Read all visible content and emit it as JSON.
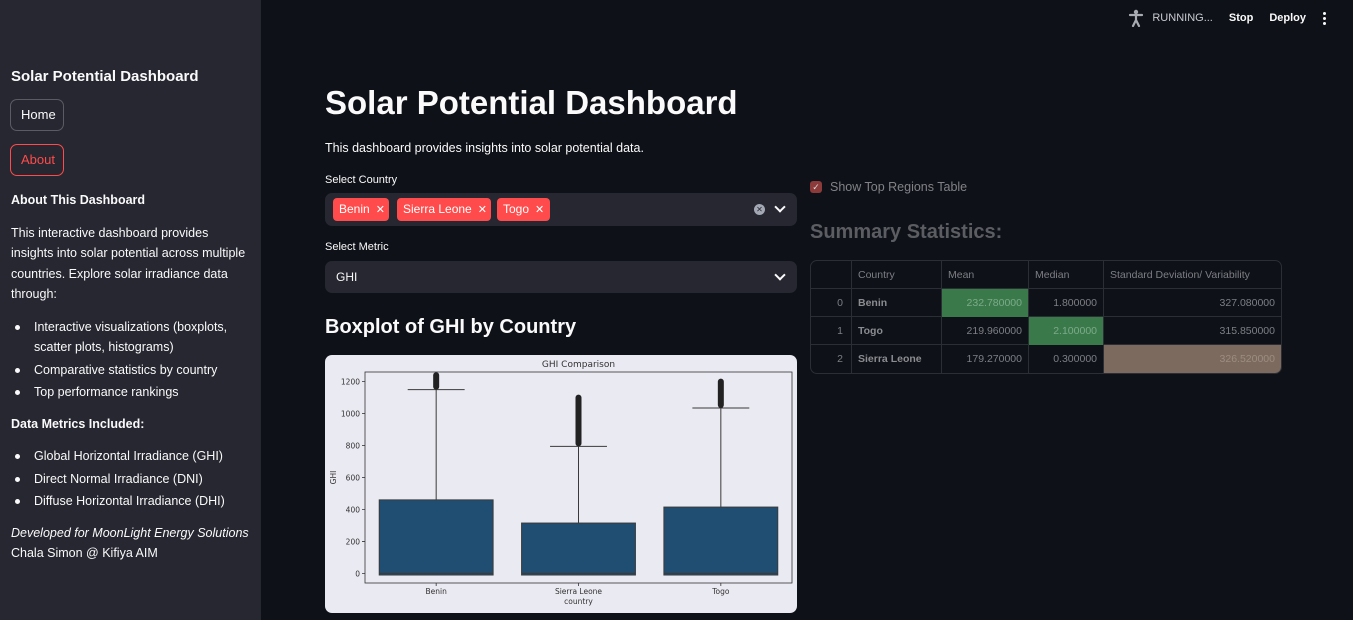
{
  "sidebar": {
    "title": "Solar Potential Dashboard",
    "home_label": "Home",
    "about_label": "About",
    "about_heading": "About This Dashboard",
    "about_text": "This interactive dashboard provides insights into solar potential across multiple countries. Explore solar irradiance data through:",
    "features": [
      "Interactive visualizations (boxplots, scatter plots, histograms)",
      "Comparative statistics by country",
      "Top performance rankings"
    ],
    "metrics_heading": "Data Metrics Included:",
    "metrics": [
      "Global Horizontal Irradiance (GHI)",
      "Direct Normal Irradiance (DNI)",
      "Diffuse Horizontal Irradiance (DHI)"
    ],
    "developed_for": "Developed for MoonLight Energy Solutions",
    "author": "Chala Simon @ Kifiya AIM"
  },
  "topbar": {
    "status": "RUNNING...",
    "stop_label": "Stop",
    "deploy_label": "Deploy"
  },
  "main": {
    "title": "Solar Potential Dashboard",
    "intro": "This dashboard provides insights into solar potential data.",
    "country_label": "Select Country",
    "countries_selected": [
      "Benin",
      "Sierra Leone",
      "Togo"
    ],
    "metric_label": "Select Metric",
    "metric_value": "GHI",
    "boxplot_title": "Boxplot of GHI by Country"
  },
  "right": {
    "checkbox_label": "Show Top Regions Table",
    "summary_title": "Summary Statistics:",
    "table": {
      "headers": [
        "",
        "Country",
        "Mean",
        "Median",
        "Standard Deviation/ Variability"
      ],
      "rows": [
        [
          "0",
          "Benin",
          "232.780000",
          "1.800000",
          "327.080000"
        ],
        [
          "1",
          "Togo",
          "219.960000",
          "2.100000",
          "315.850000"
        ],
        [
          "2",
          "Sierra Leone",
          "179.270000",
          "0.300000",
          "326.520000"
        ]
      ]
    }
  },
  "colors": {
    "accent": "#ff4b4b",
    "box_fill": "#1f4e72",
    "plot_bg": "#eaeaf2"
  },
  "chart_data": {
    "type": "boxplot",
    "title": "GHI Comparison",
    "xlabel": "country",
    "ylabel": "GHI",
    "ylim": [
      -60,
      1260
    ],
    "yticks": [
      0,
      200,
      400,
      600,
      800,
      1000,
      1200
    ],
    "categories": [
      "Benin",
      "Sierra Leone",
      "Togo"
    ],
    "boxes": [
      {
        "name": "Benin",
        "min": -10,
        "q1": -10,
        "median": 0,
        "q3": 460,
        "whisker_high": 1150,
        "outlier_max": 1240
      },
      {
        "name": "Sierra Leone",
        "min": -10,
        "q1": -10,
        "median": 0,
        "q3": 315,
        "whisker_high": 795,
        "outlier_max": 1100
      },
      {
        "name": "Togo",
        "min": -10,
        "q1": -10,
        "median": 0,
        "q3": 415,
        "whisker_high": 1035,
        "outlier_max": 1200
      }
    ]
  }
}
